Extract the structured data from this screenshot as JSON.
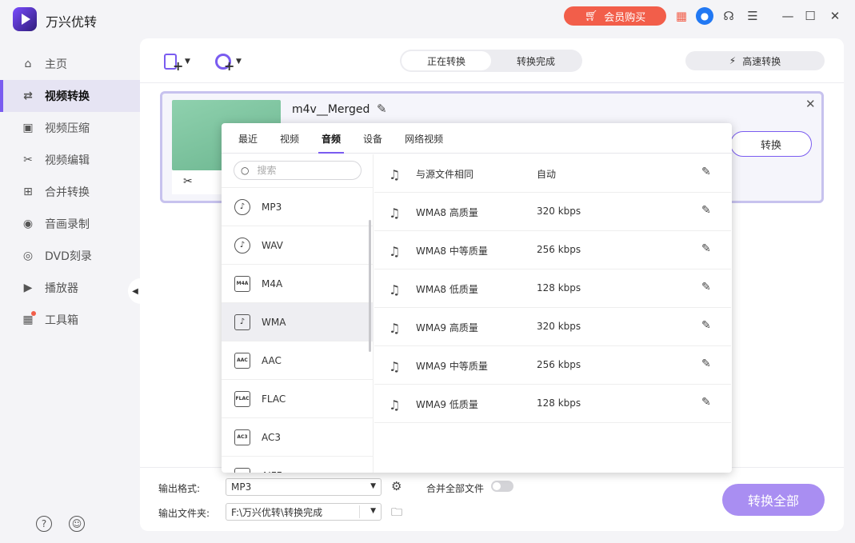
{
  "app": {
    "title": "万兴优转",
    "vip_label": "会员购买"
  },
  "sidebar": {
    "items": [
      {
        "label": "主页",
        "icon": "home-icon",
        "glyph": "⌂"
      },
      {
        "label": "视频转换",
        "icon": "convert-icon",
        "glyph": "⇄"
      },
      {
        "label": "视频压缩",
        "icon": "compress-icon",
        "glyph": "▣"
      },
      {
        "label": "视频编辑",
        "icon": "scissors-icon",
        "glyph": "✂"
      },
      {
        "label": "合并转换",
        "icon": "merge-icon",
        "glyph": "⊞"
      },
      {
        "label": "音画录制",
        "icon": "record-icon",
        "glyph": "◉"
      },
      {
        "label": "DVD刻录",
        "icon": "dvd-icon",
        "glyph": "◎"
      },
      {
        "label": "播放器",
        "icon": "player-icon",
        "glyph": "▶"
      },
      {
        "label": "工具箱",
        "icon": "toolbox-icon",
        "glyph": "▦"
      }
    ],
    "active_index": 1
  },
  "toolbar": {
    "tabs": [
      "正在转换",
      "转换完成"
    ],
    "turbo_label": "高速转换"
  },
  "file": {
    "name": "m4v__Merged",
    "convert_label": "转换"
  },
  "popup": {
    "tabs": [
      "最近",
      "视频",
      "音频",
      "设备",
      "网络视频"
    ],
    "active_tab": "音频",
    "search_placeholder": "搜索",
    "formats": [
      {
        "label": "MP3",
        "icon_text": "♪",
        "round": true
      },
      {
        "label": "WAV",
        "icon_text": "♪",
        "round": true
      },
      {
        "label": "M4A",
        "icon_text": "M4A",
        "round": false
      },
      {
        "label": "WMA",
        "icon_text": "♪",
        "round": false
      },
      {
        "label": "AAC",
        "icon_text": "AAC",
        "round": false
      },
      {
        "label": "FLAC",
        "icon_text": "FLAC",
        "round": false
      },
      {
        "label": "AC3",
        "icon_text": "AC3",
        "round": false
      },
      {
        "label": "AIFF",
        "icon_text": "AIFF",
        "round": false
      }
    ],
    "selected_format": "WMA",
    "presets": [
      {
        "name": "与源文件相同",
        "rate": "自动"
      },
      {
        "name": "WMA8 高质量",
        "rate": "320 kbps"
      },
      {
        "name": "WMA8 中等质量",
        "rate": "256 kbps"
      },
      {
        "name": "WMA8 低质量",
        "rate": "128 kbps"
      },
      {
        "name": "WMA9 高质量",
        "rate": "320 kbps"
      },
      {
        "name": "WMA9 中等质量",
        "rate": "256 kbps"
      },
      {
        "name": "WMA9 低质量",
        "rate": "128 kbps"
      }
    ]
  },
  "bottom": {
    "format_label": "输出格式:",
    "format_value": "MP3",
    "folder_label": "输出文件夹:",
    "folder_value": "F:\\万兴优转\\转换完成",
    "merge_label": "合并全部文件",
    "merge_on": false,
    "convert_all_label": "转换全部"
  },
  "colors": {
    "accent": "#7a5cf0",
    "vip": "#f25e4a",
    "convert_all": "#a98ef2"
  }
}
